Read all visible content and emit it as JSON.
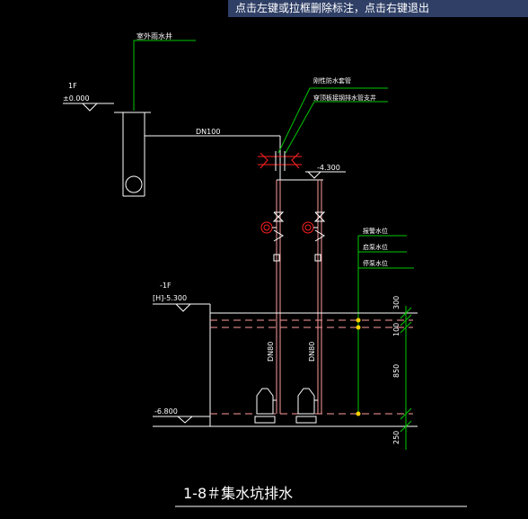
{
  "hint": "点击左键或拉框删除标注，点击右键退出",
  "drawing": {
    "outdoor_pipe_label": "室外雨水井",
    "floor1_label": "1F",
    "floor1_elev": "±0.000",
    "pipe_dn100": "DN100",
    "valve_note1": "刚性防水套管",
    "valve_note2": "穿顶板接钢排水管支井",
    "elev_minus_4300": "-4.300",
    "alarm_level": "报警水位",
    "start_level": "启泵水位",
    "stop_level": "停泵水位",
    "floorb1_label": "-1F",
    "floorb1_elev": "[H]-5.300",
    "riser_left": "DN80",
    "riser_right": "DN80",
    "dim_300": "300",
    "dim_100": "100",
    "dim_850": "850",
    "dim_250": "250",
    "bottom_elev": "-6.800",
    "title": "1-8＃集水坑排水"
  },
  "colors": {
    "green": "#00c800",
    "white": "#ffffff",
    "yellow": "#ffd200",
    "pink": "#ff9c9c",
    "red": "#ff2020",
    "hint_bg": "#2f3f66"
  }
}
